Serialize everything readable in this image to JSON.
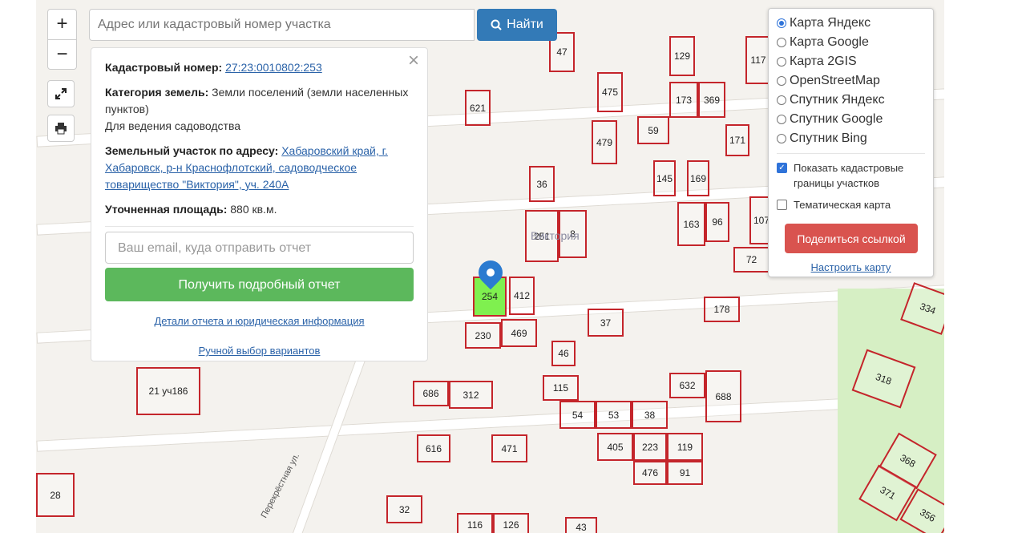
{
  "controls": {
    "zoom_in": "+",
    "zoom_out": "−"
  },
  "search": {
    "placeholder": "Адрес или кадастровый номер участка",
    "button_label": "Найти"
  },
  "info": {
    "cadastral_label": "Кадастровый номер:",
    "cadastral_value": "27:23:0010802:253",
    "category_label": "Категория земель:",
    "category_value": "Земли поселений (земли населенных пунктов)",
    "usage": "Для ведения садоводства",
    "address_label": "Земельный участок по адресу:",
    "address_value": "Хабаровский край, г. Хабаровск, р-н Краснофлотский, садоводческое товарищество \"Виктория\", уч. 240А",
    "area_label": "Уточненная площадь:",
    "area_value": "880 кв.м.",
    "email_placeholder": "Ваш email, куда отправить отчет",
    "report_button": "Получить подробный отчет",
    "details_link": "Детали отчета и юридическая информация",
    "manual_link": "Ручной выбор вариантов"
  },
  "layers": {
    "options": [
      "Карта Яндекс",
      "Карта Google",
      "Карта 2GIS",
      "OpenStreetMap",
      "Спутник Яндекс",
      "Спутник Google",
      "Спутник Bing"
    ],
    "selected": "Карта Яндекс",
    "show_boundaries": "Показать кадастровые границы участков",
    "thematic": "Тематическая карта",
    "share_button": "Поделиться ссылкой",
    "config_link": "Настроить карту"
  },
  "map": {
    "street": "Перекрёстная ул.",
    "area_label": "Виктория",
    "plots": [
      "47",
      "129",
      "117",
      "475",
      "173",
      "369",
      "621",
      "59",
      "479",
      "171",
      "145",
      "169",
      "36",
      "251",
      "8",
      "163",
      "96",
      "107",
      "72",
      "254",
      "412",
      "178",
      "37",
      "230",
      "469",
      "46",
      "21 уч186",
      "686",
      "312",
      "115",
      "632",
      "688",
      "54",
      "53",
      "38",
      "318",
      "334",
      "616",
      "471",
      "405",
      "223",
      "119",
      "476",
      "91",
      "368",
      "371",
      "356",
      "28",
      "32",
      "116",
      "126",
      "43"
    ]
  },
  "colors": {
    "plot_border": "#c4252b",
    "selected_plot": "#7ff04f",
    "search_button": "#337ab7",
    "report_button": "#5cb85c",
    "share_button": "#d9534f"
  }
}
